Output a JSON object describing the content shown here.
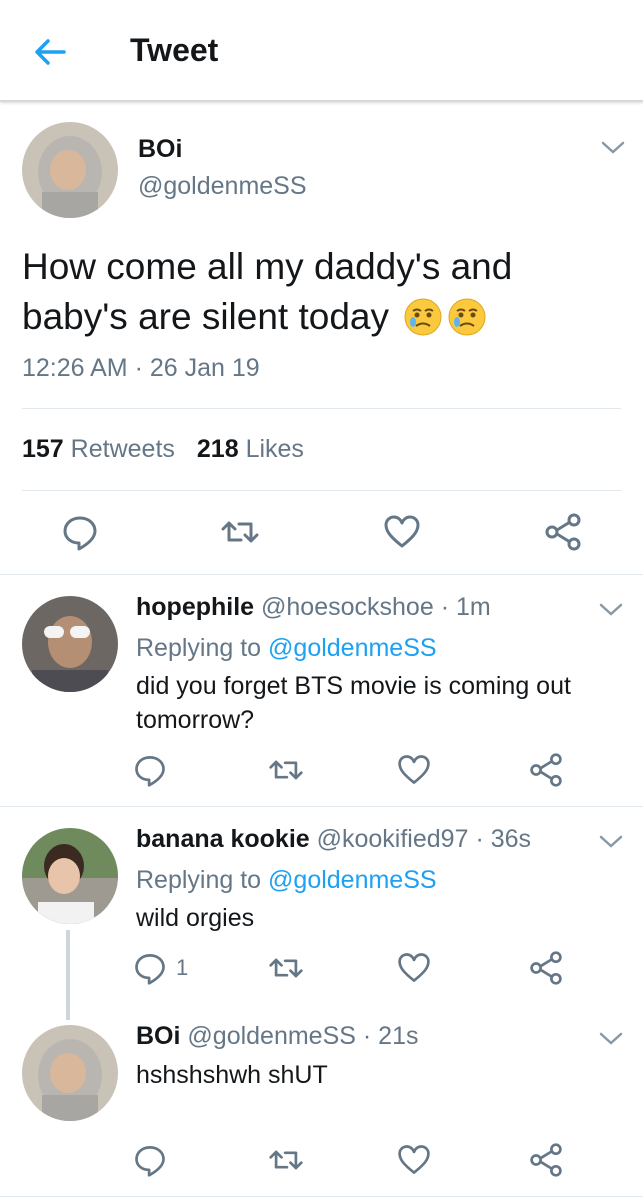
{
  "header": {
    "title": "Tweet",
    "back_icon": "arrow-left-icon",
    "accent": "#1da1f2"
  },
  "tweet": {
    "display_name": "BOi",
    "handle": "@goldenmeSS",
    "text": "How come all my daddy's and baby's are silent today",
    "emojis": [
      "crying-face-emoji",
      "crying-face-emoji"
    ],
    "timestamp": "12:26 AM · 26 Jan 19",
    "retweets_count": "157",
    "retweets_label": "Retweets",
    "likes_count": "218",
    "likes_label": "Likes"
  },
  "replies": [
    {
      "display_name": "hopephile",
      "handle": "@hoesockshoe",
      "time": "· 1m",
      "replying_label": "Replying to",
      "replying_to": "@goldenmeSS",
      "text": "did you forget BTS movie is coming out tomorrow?",
      "reply_count": ""
    },
    {
      "display_name": "banana kookie",
      "handle": "@kookified97",
      "time": "· 36s",
      "replying_label": "Replying to",
      "replying_to": "@goldenmeSS",
      "text": "wild orgies",
      "reply_count": "1"
    },
    {
      "display_name": "BOi",
      "handle": "@goldenmeSS",
      "time": "· 21s",
      "text": "hshshshwh shUT",
      "reply_count": ""
    }
  ],
  "colors": {
    "text": "#14171a",
    "secondary": "#657786",
    "link": "#1da1f2",
    "icon": "#657786",
    "divider": "#e1e8ed"
  }
}
